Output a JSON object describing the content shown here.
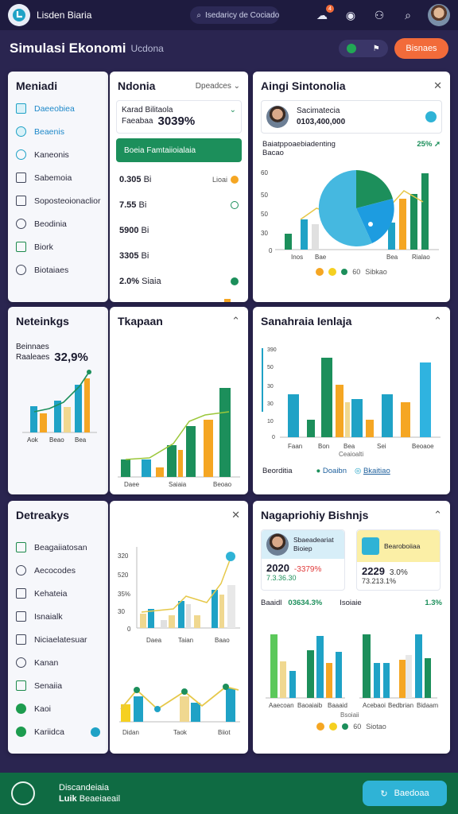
{
  "topbar": {
    "brand": "Lisden Biaria",
    "search_text": "Isedaricy de Cociado",
    "notification_count": "4"
  },
  "header": {
    "title": "Simulasi Ekonomi",
    "subtitle": "Ucdona",
    "cta_label": "Bisnaes"
  },
  "sidebar1": {
    "title": "Meniadi",
    "items": [
      {
        "label": "Daeeobiea",
        "icon": "grid-icon"
      },
      {
        "label": "Beaenis",
        "icon": "chat-icon"
      },
      {
        "label": "Kaneonis",
        "icon": "comment-icon"
      },
      {
        "label": "Sabemoia",
        "icon": "box-icon"
      },
      {
        "label": "Soposteoionaclior",
        "icon": "box-icon"
      },
      {
        "label": "Beodinia",
        "icon": "wallet-icon"
      },
      {
        "label": "Biork",
        "icon": "briefcase-icon"
      },
      {
        "label": "Biotaiaes",
        "icon": "gear-icon"
      }
    ]
  },
  "sidebar2": {
    "title": "Neteinkgs",
    "label1": "Beinnaes",
    "label2": "Raaleaes",
    "value": "32,9%",
    "axis": [
      "Aok",
      "Beao",
      "Bea"
    ]
  },
  "sidebar3": {
    "title": "Detreakys",
    "items": [
      {
        "label": "Beagaiiatosan",
        "icon": "chart-icon"
      },
      {
        "label": "Aecocodes",
        "icon": "shield-icon"
      },
      {
        "label": "Kehateia",
        "icon": "image-icon"
      },
      {
        "label": "Isnaialk",
        "icon": "box-icon"
      },
      {
        "label": "Niciaelatesuar",
        "icon": "box-icon"
      },
      {
        "label": "Kanan",
        "icon": "chat-icon"
      },
      {
        "label": "Senaiia",
        "icon": "chart-icon"
      },
      {
        "label": "Kaoi",
        "icon": "dot-icon"
      },
      {
        "label": "Kariidca",
        "icon": "dot-icon"
      }
    ]
  },
  "card_ndonia": {
    "title": "Ndonia",
    "dropdown": "Dpeadces",
    "kv_label": "Karad Bilitaola",
    "kv_sub": "Faeabaa",
    "kv_value": "3039%",
    "green_label": "Boeia Famtaiioialaia",
    "rows": [
      {
        "value": "0.305",
        "unit": "Bi",
        "chip": "Lioai"
      },
      {
        "value": "7.55",
        "unit": "Bi",
        "chip": ""
      },
      {
        "value": "5900",
        "unit": "Bi",
        "chip": ""
      },
      {
        "value": "3305",
        "unit": "Bi",
        "chip": ""
      },
      {
        "value": "2.0%",
        "unit": "Siaia",
        "chip": ""
      }
    ],
    "colors": {
      "teal": "#1fa2c6",
      "green": "#1c8f5b",
      "orange": "#f5a623"
    }
  },
  "card_sintonolia": {
    "title": "Aingi Sintonolia",
    "profile_name": "Sacimatecia",
    "profile_value": "0103,400,000",
    "metric_label": "Baiatppoaebiadenting",
    "metric_sub": "Bacao",
    "metric_value": "25%",
    "y_ticks": [
      "60",
      "50",
      "50",
      "30",
      "0"
    ],
    "x_labels": [
      "Inos",
      "Bae",
      "Bea",
      "Rialao"
    ],
    "legend": "Sibkao",
    "legend_num": "60"
  },
  "card_tkapaan": {
    "title": "Tkapaan",
    "x_labels": [
      "Daee",
      "Saiaia",
      "Beoao"
    ]
  },
  "card_senahraia": {
    "title": "Sanahraia Ienlaja",
    "y_ticks": [
      "390",
      "50",
      "30",
      "30",
      "10",
      "0"
    ],
    "x_labels": [
      "Faan",
      "Bon",
      "Bea",
      "Sei",
      "Beoaoe"
    ],
    "x_caption": "Ceaioalti",
    "legend_left": "Beorditia",
    "legend_a": "Doaibn",
    "legend_b": "Bkaitiao"
  },
  "card_detail": {
    "y_ticks": [
      "320",
      "520",
      "35%",
      "30",
      "0"
    ],
    "x_labels": [
      "Daea",
      "Taian",
      "Baao"
    ],
    "x_labels2": [
      "Didan",
      "Taok",
      "Biiot"
    ]
  },
  "card_nagaprionty": {
    "title": "Nagapriohiy Bishnjs",
    "left": {
      "label1": "Sbaeadeariat",
      "label2": "Bioiep",
      "year": "2020",
      "pct": "-3379%",
      "sub": "7.3.36.30"
    },
    "right": {
      "label1": "Bearoboiiaa",
      "year": "2229",
      "pct": "3.0%",
      "sub": "73.213.1%"
    },
    "row_left_label": "Baaidl",
    "row_left_value": "03634.3%",
    "row_right_label": "Isoiaie",
    "row_right_value": "1.3%",
    "x_labels_left": [
      "Aaecoan",
      "Baoaiaib",
      "Baaaid"
    ],
    "x_labels_right": [
      "Acebaoi",
      "Bedbrian",
      "Bidaam"
    ],
    "caption": "Bsoiaii",
    "legend_num": "60",
    "legend_txt": "Siotao"
  },
  "footer": {
    "line1": "Discandeiaia",
    "line2": "Beaeiaeail",
    "tag": "Luik",
    "button": "Baedoaa"
  }
}
